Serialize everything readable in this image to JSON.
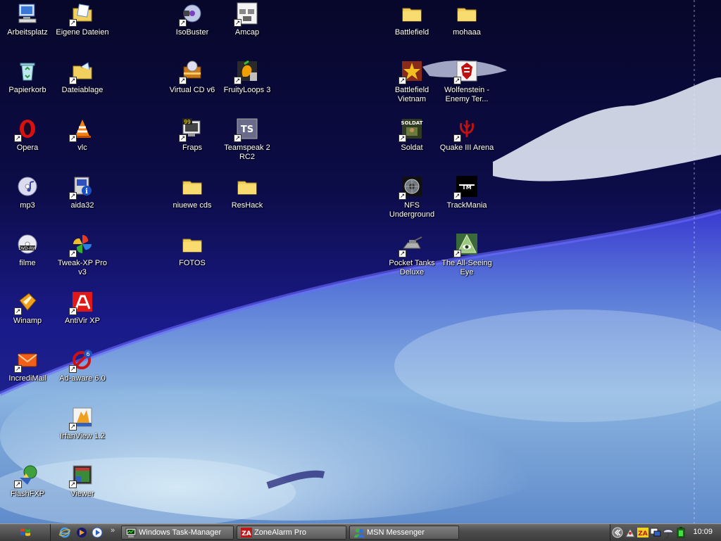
{
  "desktop": {
    "icons": [
      {
        "label": "Arbeitsplatz",
        "icon": "my-computer-icon"
      },
      {
        "label": "Eigene Dateien",
        "icon": "my-documents-icon"
      },
      {
        "label": "Papierkorb",
        "icon": "recycle-bin-icon"
      },
      {
        "label": "Dateiablage",
        "icon": "folder-icon"
      },
      {
        "label": "Opera",
        "icon": "opera-icon"
      },
      {
        "label": "vlc",
        "icon": "vlc-cone-icon"
      },
      {
        "label": "mp3",
        "icon": "cd-audio-icon"
      },
      {
        "label": "aida32",
        "icon": "aida32-icon"
      },
      {
        "label": "filme",
        "icon": "dvd-rw-icon"
      },
      {
        "label": "Tweak-XP Pro v3",
        "icon": "tweak-xp-icon"
      },
      {
        "label": "Winamp",
        "icon": "winamp-icon"
      },
      {
        "label": "AntiVir XP",
        "icon": "antivir-icon"
      },
      {
        "label": "IncrediMail",
        "icon": "incredimail-icon"
      },
      {
        "label": "Ad-aware 6.0",
        "icon": "adaware-icon"
      },
      {
        "label": "IrfanView 1.2",
        "icon": "irfanview-icon"
      },
      {
        "label": "FlashFXP",
        "icon": "flashfxp-icon"
      },
      {
        "label": "Viewer",
        "icon": "viewer-icon"
      },
      {
        "label": "IsoBuster",
        "icon": "isobuster-icon"
      },
      {
        "label": "Amcap",
        "icon": "amcap-icon"
      },
      {
        "label": "Virtual CD v6",
        "icon": "virtual-cd-icon"
      },
      {
        "label": "FruityLoops 3",
        "icon": "fruityloops-icon"
      },
      {
        "label": "Fraps",
        "icon": "fraps-icon"
      },
      {
        "label": "Teamspeak 2 RC2",
        "icon": "teamspeak-icon"
      },
      {
        "label": "niuewe cds",
        "icon": "folder-icon"
      },
      {
        "label": "ResHack",
        "icon": "folder-icon"
      },
      {
        "label": "FOTOS",
        "icon": "folder-icon"
      },
      {
        "label": "Battlefield",
        "icon": "folder-icon"
      },
      {
        "label": "mohaaa",
        "icon": "folder-icon"
      },
      {
        "label": "Battlefield Vietnam",
        "icon": "battlefield-vietnam-icon"
      },
      {
        "label": "Wolfenstein - Enemy Ter...",
        "icon": "wolfenstein-icon"
      },
      {
        "label": "Soldat",
        "icon": "soldat-icon"
      },
      {
        "label": "Quake III Arena",
        "icon": "quake3-icon"
      },
      {
        "label": "NFS Underground",
        "icon": "nfs-underground-icon"
      },
      {
        "label": "TrackMania",
        "icon": "trackmania-icon"
      },
      {
        "label": "Pocket Tanks Deluxe",
        "icon": "pocket-tanks-icon"
      },
      {
        "label": "The All-Seeing Eye",
        "icon": "all-seeing-eye-icon"
      }
    ]
  },
  "taskbar": {
    "tasks": [
      {
        "label": "Windows Task-Manager",
        "icon": "task-manager-icon"
      },
      {
        "label": "ZoneAlarm Pro",
        "icon": "zonealarm-icon"
      },
      {
        "label": "MSN Messenger",
        "icon": "msn-messenger-icon"
      }
    ],
    "quick_launch": [
      "ie-icon",
      "real-player-icon",
      "media-player-icon"
    ],
    "tray_icons": [
      "expand-tray-icon",
      "network-icon",
      "zonealarm-icon",
      "display-icon",
      "antivir-umbrella-icon",
      "battery-icon"
    ],
    "clock": "10:09"
  }
}
